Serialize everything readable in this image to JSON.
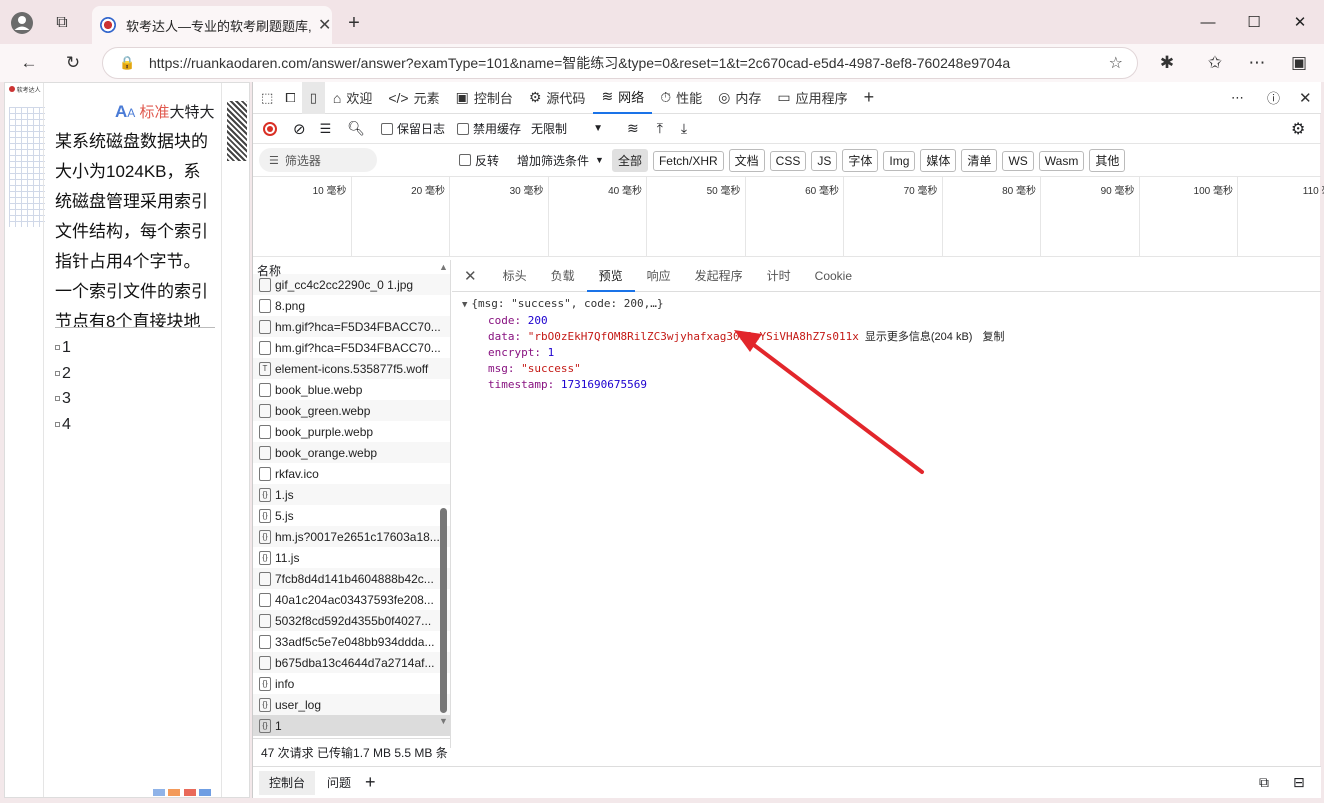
{
  "browser": {
    "tab_title": "软考达人—专业的软考刷题题库,",
    "url": "https://ruankaodaren.com/answer/answer?examType=101&name=智能练习&type=0&reset=1&t=2c670cad-e5d4-4987-8ef8-760248e9704a"
  },
  "page": {
    "logo_text": "软考达人",
    "font_label_std": "标准",
    "font_label_large": "大",
    "font_label_xlarge": "特大",
    "question": "某系统磁盘数据块的大小为1024KB，系统磁盘管理采用索引文件结构，每个索引指针占用4个字节。一个索引文件的索引节点有8个直接块地",
    "options": [
      "1",
      "2",
      "3",
      "4"
    ]
  },
  "devtools": {
    "tabs": [
      {
        "icon": "⌂",
        "label": "欢迎"
      },
      {
        "icon": "</>",
        "label": "元素"
      },
      {
        "icon": "▣",
        "label": "控制台"
      },
      {
        "icon": "⚙",
        "label": "源代码"
      },
      {
        "icon": "≋",
        "label": "网络"
      },
      {
        "icon": "⏱",
        "label": "性能"
      },
      {
        "icon": "◎",
        "label": "内存"
      },
      {
        "icon": "▭",
        "label": "应用程序"
      }
    ],
    "toolbar": {
      "preserve_log": "保留日志",
      "disable_cache": "禁用缓存",
      "throttle": "无限制"
    },
    "filter": {
      "placeholder": "筛选器",
      "invert": "反转",
      "more_filters": "增加筛选条件",
      "chips": [
        "全部",
        "Fetch/XHR",
        "文档",
        "CSS",
        "JS",
        "字体",
        "Img",
        "媒体",
        "清单",
        "WS",
        "Wasm",
        "其他"
      ]
    },
    "timeline_ticks": [
      "10 毫秒",
      "20 毫秒",
      "30 毫秒",
      "40 毫秒",
      "50 毫秒",
      "60 毫秒",
      "70 毫秒",
      "80 毫秒",
      "90 毫秒",
      "100 毫秒",
      "110 毫"
    ],
    "request_list": {
      "header": "名称",
      "items": [
        "gif_cc4c2cc2290c_0 1.jpg",
        "8.png",
        "hm.gif?hca=F5D34FBACC70...",
        "hm.gif?hca=F5D34FBACC70...",
        "element-icons.535877f5.woff",
        "book_blue.webp",
        "book_green.webp",
        "book_purple.webp",
        "book_orange.webp",
        "rkfav.ico",
        "1.js",
        "5.js",
        "hm.js?0017e2651c17603a18...",
        "11.js",
        "7fcb8d4d141b4604888b42c...",
        "40a1c204ac03437593fe208...",
        "5032f8cd592d4355b0f4027...",
        "33adf5c5e7e048bb934ddda...",
        "b675dba13c4644d7a2714af...",
        "info",
        "user_log",
        "1"
      ]
    },
    "status": "47 次请求   已传输1.7 MB   5.5 MB 条",
    "detail_tabs": [
      "标头",
      "负载",
      "预览",
      "响应",
      "发起程序",
      "计时",
      "Cookie"
    ],
    "preview": {
      "summary": "{msg: \"success\", code: 200,…}",
      "code_key": "code:",
      "code_val": "200",
      "data_key": "data:",
      "data_val": "\"rbO0zEkH7QfOM8RilZC3wjyhafxag30W3eYSiVHA8hZ7s011x",
      "show_more": "显示更多信息(204 kB)",
      "copy": "复制",
      "encrypt_key": "encrypt:",
      "encrypt_val": "1",
      "msg_key": "msg:",
      "msg_val": "\"success\"",
      "ts_key": "timestamp:",
      "ts_val": "1731690675569"
    },
    "drawer_tabs": [
      "控制台",
      "问题"
    ]
  },
  "colors": {
    "accent_blue": "#1a73e8",
    "record_red": "#d93025",
    "arrow_red": "#e2262b"
  }
}
